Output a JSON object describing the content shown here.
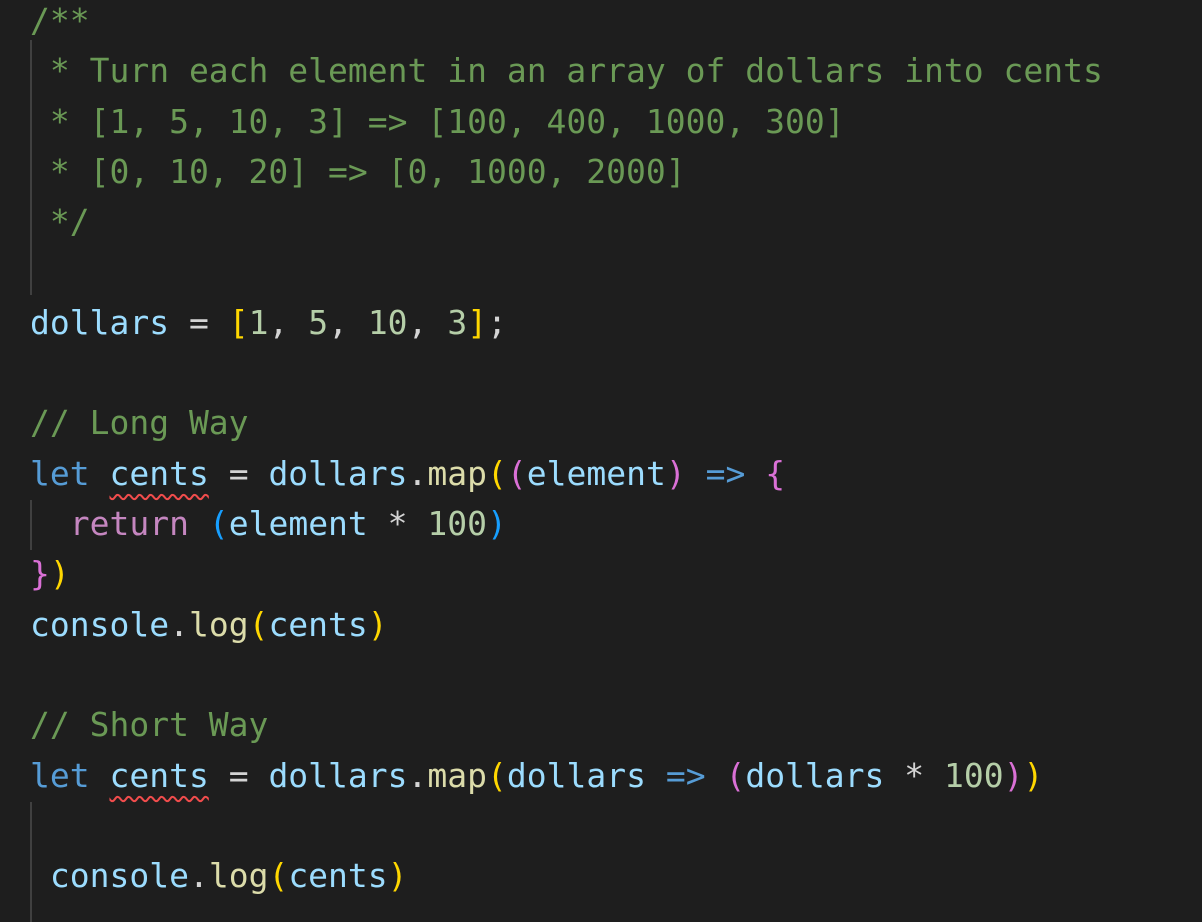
{
  "editor": {
    "theme_colors": {
      "background": "#1e1e1e",
      "comment": "#6a9955",
      "variable": "#9cdcfe",
      "keyword": "#569cd6",
      "control_keyword": "#c586c0",
      "function": "#dcdcaa",
      "number": "#b5cea8",
      "bracket_level_1": "#ffd700",
      "bracket_level_2": "#da70d6",
      "bracket_level_3": "#179fff",
      "error_squiggle": "#f14c4c"
    },
    "lines": [
      {
        "tokens": [
          {
            "t": "/**",
            "c": "comment"
          }
        ]
      },
      {
        "tokens": [
          {
            "t": " * Turn each element in an array of dollars into cents",
            "c": "comment"
          }
        ]
      },
      {
        "tokens": [
          {
            "t": " * [1, 5, 10, 3] => [100, 400, 1000, 300]",
            "c": "comment"
          }
        ]
      },
      {
        "tokens": [
          {
            "t": " * [0, 10, 20] => [0, 1000, 2000]",
            "c": "comment"
          }
        ]
      },
      {
        "tokens": [
          {
            "t": " */",
            "c": "comment"
          }
        ]
      },
      {
        "tokens": []
      },
      {
        "tokens": [
          {
            "t": "dollars",
            "c": "ident"
          },
          {
            "t": " = ",
            "c": "op"
          },
          {
            "t": "[",
            "c": "b1"
          },
          {
            "t": "1",
            "c": "num"
          },
          {
            "t": ", ",
            "c": "op"
          },
          {
            "t": "5",
            "c": "num"
          },
          {
            "t": ", ",
            "c": "op"
          },
          {
            "t": "10",
            "c": "num"
          },
          {
            "t": ", ",
            "c": "op"
          },
          {
            "t": "3",
            "c": "num"
          },
          {
            "t": "]",
            "c": "b1"
          },
          {
            "t": ";",
            "c": "op"
          }
        ]
      },
      {
        "tokens": []
      },
      {
        "tokens": [
          {
            "t": "// Long Way",
            "c": "comment"
          }
        ]
      },
      {
        "tokens": [
          {
            "t": "let",
            "c": "keyword"
          },
          {
            "t": " ",
            "c": "op"
          },
          {
            "t": "cents",
            "c": "ident",
            "error": true
          },
          {
            "t": " = ",
            "c": "op"
          },
          {
            "t": "dollars",
            "c": "ident"
          },
          {
            "t": ".",
            "c": "op"
          },
          {
            "t": "map",
            "c": "func"
          },
          {
            "t": "(",
            "c": "b1"
          },
          {
            "t": "(",
            "c": "b2"
          },
          {
            "t": "element",
            "c": "ident"
          },
          {
            "t": ")",
            "c": "b2"
          },
          {
            "t": " ",
            "c": "op"
          },
          {
            "t": "=>",
            "c": "keyword"
          },
          {
            "t": " ",
            "c": "op"
          },
          {
            "t": "{",
            "c": "b2"
          }
        ]
      },
      {
        "tokens": [
          {
            "t": "  ",
            "c": "op"
          },
          {
            "t": "return",
            "c": "control"
          },
          {
            "t": " ",
            "c": "op"
          },
          {
            "t": "(",
            "c": "b3"
          },
          {
            "t": "element",
            "c": "ident"
          },
          {
            "t": " * ",
            "c": "op"
          },
          {
            "t": "100",
            "c": "num"
          },
          {
            "t": ")",
            "c": "b3"
          }
        ]
      },
      {
        "tokens": [
          {
            "t": "}",
            "c": "b2"
          },
          {
            "t": ")",
            "c": "b1"
          }
        ]
      },
      {
        "tokens": [
          {
            "t": "console",
            "c": "ident"
          },
          {
            "t": ".",
            "c": "op"
          },
          {
            "t": "log",
            "c": "func"
          },
          {
            "t": "(",
            "c": "b1"
          },
          {
            "t": "cents",
            "c": "ident"
          },
          {
            "t": ")",
            "c": "b1"
          }
        ]
      },
      {
        "tokens": []
      },
      {
        "tokens": [
          {
            "t": "// Short Way",
            "c": "comment"
          }
        ]
      },
      {
        "tokens": [
          {
            "t": "let",
            "c": "keyword"
          },
          {
            "t": " ",
            "c": "op"
          },
          {
            "t": "cents",
            "c": "ident",
            "error": true
          },
          {
            "t": " = ",
            "c": "op"
          },
          {
            "t": "dollars",
            "c": "ident"
          },
          {
            "t": ".",
            "c": "op"
          },
          {
            "t": "map",
            "c": "func"
          },
          {
            "t": "(",
            "c": "b1"
          },
          {
            "t": "dollars",
            "c": "ident"
          },
          {
            "t": " ",
            "c": "op"
          },
          {
            "t": "=>",
            "c": "keyword"
          },
          {
            "t": " ",
            "c": "op"
          },
          {
            "t": "(",
            "c": "b2"
          },
          {
            "t": "dollars",
            "c": "ident"
          },
          {
            "t": " * ",
            "c": "op"
          },
          {
            "t": "100",
            "c": "num"
          },
          {
            "t": ")",
            "c": "b2"
          },
          {
            "t": ")",
            "c": "b1"
          }
        ]
      },
      {
        "tokens": []
      },
      {
        "tokens": [
          {
            "t": " ",
            "c": "op"
          },
          {
            "t": "console",
            "c": "ident"
          },
          {
            "t": ".",
            "c": "op"
          },
          {
            "t": "log",
            "c": "func"
          },
          {
            "t": "(",
            "c": "b1"
          },
          {
            "t": "cents",
            "c": "ident"
          },
          {
            "t": ")",
            "c": "b1"
          }
        ]
      }
    ]
  }
}
